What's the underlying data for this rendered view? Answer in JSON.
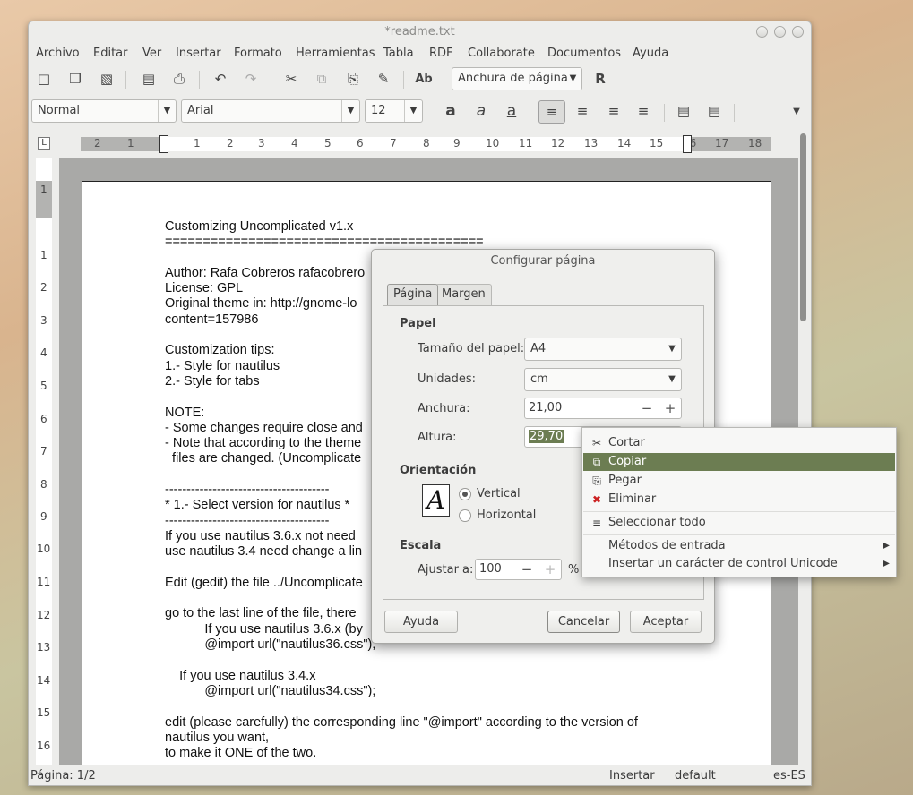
{
  "window": {
    "title": "*readme.txt"
  },
  "menubar": [
    "Archivo",
    "Editar",
    "Ver",
    "Insertar",
    "Formato",
    "Herramientas",
    "Tabla",
    "RDF",
    "Collaborate",
    "Documentos",
    "Ayuda"
  ],
  "toolbar1": {
    "zoom_value": "Anchura de página"
  },
  "toolbar2": {
    "style": "Normal",
    "font": "Arial",
    "size": "12"
  },
  "ruler": {
    "ticks": [
      "2",
      "1",
      "1",
      "2",
      "3",
      "4",
      "5",
      "6",
      "7",
      "8",
      "9",
      "10",
      "11",
      "12",
      "13",
      "14",
      "15",
      "16",
      "17",
      "18"
    ]
  },
  "vruler": {
    "ticks": [
      "1",
      "1",
      "2",
      "3",
      "4",
      "5",
      "6",
      "7",
      "8",
      "9",
      "10",
      "11",
      "12",
      "13",
      "14",
      "15",
      "16"
    ]
  },
  "document": {
    "lines": [
      "Customizing Uncomplicated v1.x",
      "==========================================",
      "",
      "Author: Rafa Cobreros rafacobrero",
      "License: GPL",
      "Original theme in: http://gnome-lo",
      "content=157986",
      "",
      "Customization tips:",
      "1.- Style for nautilus",
      "2.- Style for tabs",
      "",
      "NOTE:",
      "- Some changes require close and",
      "- Note that according to the theme",
      "  files are changed. (Uncomplicate",
      "",
      "--------------------------------------",
      "* 1.- Select version for nautilus *",
      "--------------------------------------",
      "If you use nautilus 3.6.x not need",
      "use nautilus 3.4 need change a lin",
      "",
      "Edit (gedit) the file ../Uncomplicate",
      "",
      "go to the last line of the file, there",
      "           If you use nautilus 3.6.x (by",
      "           @import url(\"nautilus36.css\");",
      "",
      "    If you use nautilus 3.4.x",
      "           @import url(\"nautilus34.css\");",
      "",
      "edit (please carefully) the corresponding line \"@import\" according to the version of",
      "nautilus you want,",
      "to make it ONE of the two."
    ]
  },
  "statusbar": {
    "page": "Página: 1/2",
    "mode": "Insertar",
    "style": "default",
    "lang": "es-ES"
  },
  "dialog": {
    "title": "Configurar página",
    "tabs": [
      "Página",
      "Margen"
    ],
    "paper_heading": "Papel",
    "paper_size_label": "Tamaño del papel:",
    "paper_size_value": "A4",
    "units_label": "Unidades:",
    "units_value": "cm",
    "width_label": "Anchura:",
    "width_value": "21,00",
    "height_label": "Altura:",
    "height_value": "29,70",
    "orientation_heading": "Orientación",
    "orientation_options": [
      "Vertical",
      "Horizontal"
    ],
    "orientation_selected": "Vertical",
    "orientation_glyph": "A",
    "scale_heading": "Escala",
    "scale_label": "Ajustar a:",
    "scale_value": "100",
    "scale_unit": "%",
    "help_button": "Ayuda",
    "cancel_button": "Cancelar",
    "accept_button": "Aceptar"
  },
  "context_menu": {
    "items": [
      "Cortar",
      "Copiar",
      "Pegar",
      "Eliminar",
      "Seleccionar todo",
      "Métodos de entrada",
      "Insertar un carácter de control Unicode"
    ],
    "highlighted": "Copiar",
    "highlight_color": "#6c7d52"
  }
}
